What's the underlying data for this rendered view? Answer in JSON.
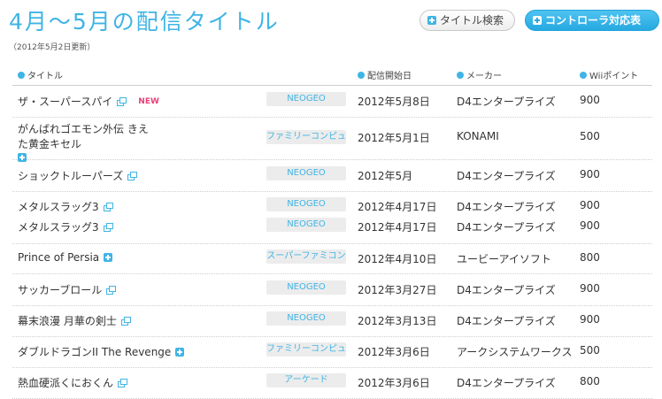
{
  "page": {
    "title": "4月～5月の配信タイトル",
    "updated": "（2012年5月2日更新）"
  },
  "buttons": {
    "search": "タイトル検索",
    "controller": "コントローラ対応表"
  },
  "columns": {
    "title": "タイトル",
    "date": "配信開始日",
    "maker": "メーカー",
    "points": "Wiiポイント"
  },
  "groups": [
    {
      "rows": [
        {
          "title": "ザ・スーパースパイ",
          "icon": "external-link-icon",
          "badge": "NEW",
          "platform": "NEOGEO",
          "date": "2012年5月8日",
          "maker": "D4エンタープライズ",
          "points": "900"
        }
      ]
    },
    {
      "rows": [
        {
          "title": "がんばれゴエモン外伝 きえた黄金キセル",
          "icon": "plus-icon",
          "platform": "ファミリーコンピュータ",
          "date": "2012年5月1日",
          "maker": "KONAMI",
          "points": "500"
        }
      ]
    },
    {
      "rows": [
        {
          "title": "ショックトルーパーズ",
          "icon": "external-link-icon",
          "platform": "NEOGEO",
          "date": "2012年5月",
          "maker": "D4エンタープライズ",
          "points": "900"
        }
      ]
    },
    {
      "rows": [
        {
          "title": "メタルスラッグ3",
          "icon": "external-link-icon",
          "platform": "NEOGEO",
          "date": "2012年4月17日",
          "maker": "D4エンタープライズ",
          "points": "900"
        },
        {
          "title": "メタルスラッグ3",
          "icon": "external-link-icon",
          "platform": "NEOGEO",
          "date": "2012年4月17日",
          "maker": "D4エンタープライズ",
          "points": "900"
        }
      ]
    },
    {
      "rows": [
        {
          "title": "Prince of Persia",
          "icon": "plus-icon",
          "platform": "スーパーファミコン",
          "date": "2012年4月10日",
          "maker": "ユービーアイソフト",
          "points": "800"
        }
      ]
    },
    {
      "rows": [
        {
          "title": "サッカーブロール",
          "icon": "external-link-icon",
          "platform": "NEOGEO",
          "date": "2012年3月27日",
          "maker": "D4エンタープライズ",
          "points": "900"
        }
      ]
    },
    {
      "rows": [
        {
          "title": "幕末浪漫 月華の剣士",
          "icon": "external-link-icon",
          "platform": "NEOGEO",
          "date": "2012年3月13日",
          "maker": "D4エンタープライズ",
          "points": "900"
        }
      ]
    },
    {
      "rows": [
        {
          "title": "ダブルドラゴンII The Revenge",
          "icon": "plus-icon",
          "platform": "ファミリーコンピュータ",
          "date": "2012年3月6日",
          "maker": "アークシステムワークス",
          "points": "500"
        }
      ]
    },
    {
      "rows": [
        {
          "title": "熱血硬派くにおくん",
          "icon": "external-link-icon",
          "platform": "アーケード",
          "date": "2012年3月6日",
          "maker": "D4エンタープライズ",
          "points": "800"
        }
      ]
    }
  ]
}
